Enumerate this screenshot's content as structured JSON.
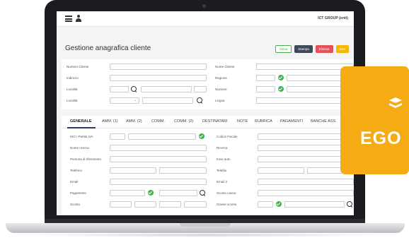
{
  "header": {
    "company": "ICT GROUP (enti)"
  },
  "page": {
    "title": "Gestione anagrafica cliente"
  },
  "actions": {
    "salva": "Salva",
    "stampa": "Stampa",
    "elimina": "Elimina",
    "esci": "Esci"
  },
  "top_form": {
    "numero_cliente": "Numero Cliente",
    "indirizzo": "Indirizzo",
    "localita": "Località",
    "localita2": "Località",
    "nome_cliente": "Nome Cliente",
    "regione": "Regione",
    "nazione": "Nazione",
    "lingua": "Lingua"
  },
  "tabs": [
    "GENERALE",
    "AMM. (1)",
    "AMM. (2)",
    "COMM.",
    "COMM. (2)",
    "DESTINATARI",
    "NOTE",
    "RUBRICA",
    "PAGAMENTI",
    "BANCHE ASS."
  ],
  "general": {
    "iso_piva": "ISO / Partita IVA",
    "nome_ricerca": "Nome ricerca",
    "persona_rif": "Persona di riferimento",
    "telefono": "Telefono",
    "email": "Email",
    "pagamento": "Pagamento",
    "sconto": "Sconto",
    "codice_fiscale": "Codice Fiscale",
    "ricerca": "Ricerca",
    "invio_auto": "Invio auto",
    "telefax": "Telefax",
    "email2": "Email 2",
    "sconto_cassa": "Sconto cassa",
    "classe_sconto": "Classe sconto"
  },
  "badge": {
    "text": "EGO"
  },
  "colors": {
    "accent": "#2d3b5b",
    "ok": "#3fb34f",
    "badge": "#f5ab14",
    "stampa": "#3f4a5a",
    "elimina": "#e25258",
    "esci": "#f5b800"
  }
}
